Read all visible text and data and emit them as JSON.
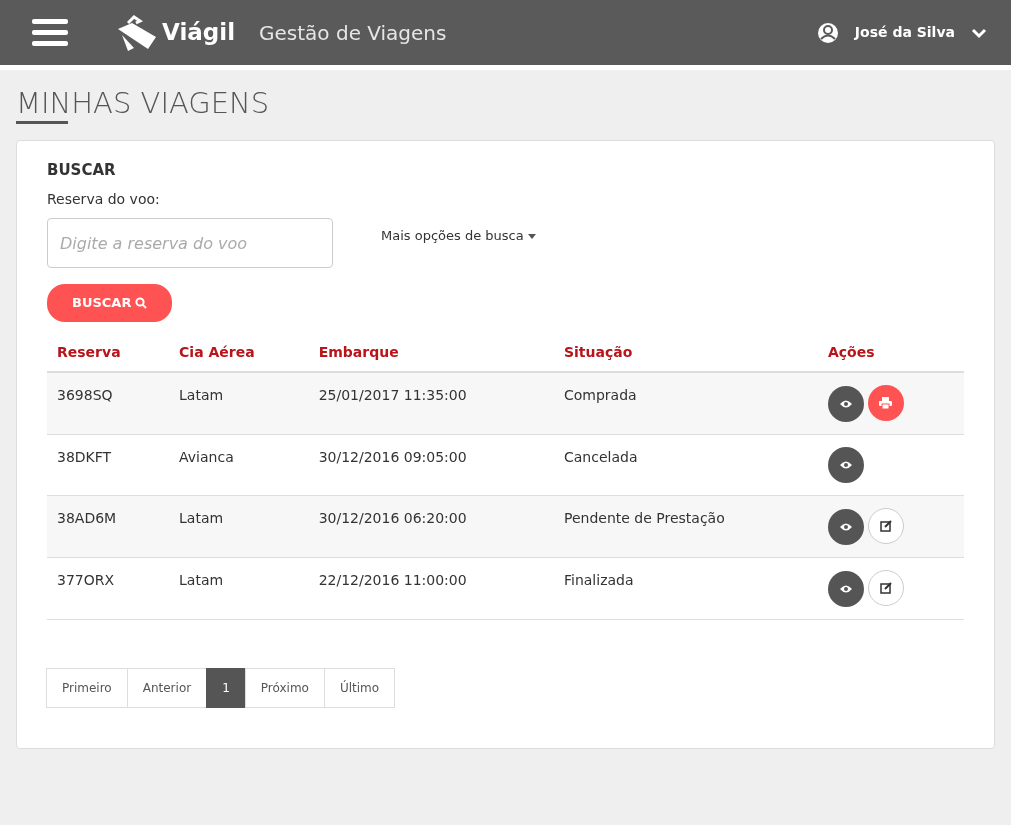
{
  "header": {
    "brand": "Viágil",
    "subtitle": "Gestão de Viagens",
    "user": "José da Silva"
  },
  "page_title": "MINHAS VIAGENS",
  "search": {
    "title": "BUSCAR",
    "label": "Reserva do voo:",
    "placeholder": "Digite a reserva do voo",
    "more_options": "Mais opções de busca",
    "button": "BUSCAR"
  },
  "table": {
    "columns": [
      "Reserva",
      "Cia Aérea",
      "Embarque",
      "Situação",
      "Ações"
    ],
    "rows": [
      {
        "cells": [
          "3698SQ",
          "Latam",
          "25/01/2017 11:35:00",
          "Comprada"
        ],
        "actions": [
          {
            "kind": "view"
          },
          {
            "kind": "print"
          }
        ]
      },
      {
        "cells": [
          "38DKFT",
          "Avianca",
          "30/12/2016 09:05:00",
          "Cancelada"
        ],
        "actions": [
          {
            "kind": "view"
          }
        ]
      },
      {
        "cells": [
          "38AD6M",
          "Latam",
          "30/12/2016 06:20:00",
          "Pendente de Prestação"
        ],
        "actions": [
          {
            "kind": "view"
          },
          {
            "kind": "edit"
          }
        ]
      },
      {
        "cells": [
          "377ORX",
          "Latam",
          "22/12/2016 11:00:00",
          "Finalizada"
        ],
        "actions": [
          {
            "kind": "view"
          },
          {
            "kind": "edit"
          }
        ]
      }
    ]
  },
  "pagination": [
    {
      "label": "Primeiro",
      "selected": false
    },
    {
      "label": "Anterior",
      "selected": false
    },
    {
      "label": "1",
      "selected": true
    },
    {
      "label": "Próximo",
      "selected": false
    },
    {
      "label": "Último",
      "selected": false
    }
  ]
}
